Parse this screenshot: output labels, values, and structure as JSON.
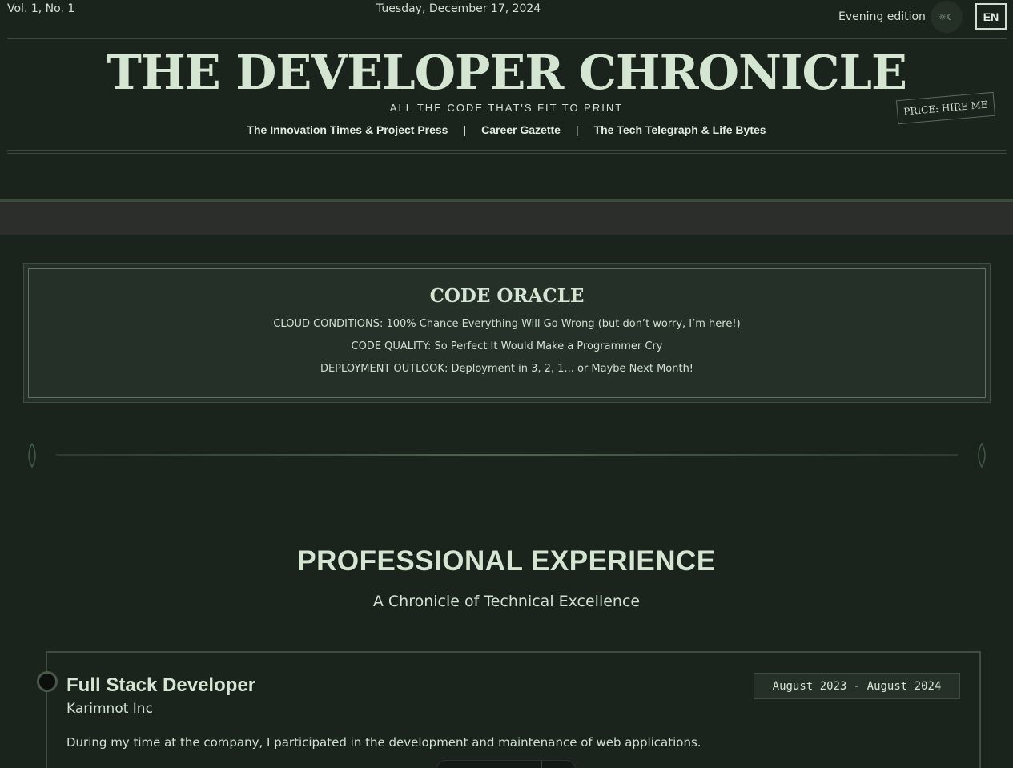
{
  "header": {
    "volume": "Vol. 1, No. 1",
    "date": "Tuesday, December 17, 2024",
    "edition": "Evening edition",
    "theme_toggle_glyph": "☼☾",
    "language": "EN",
    "masthead": "THE DEVELOPER CHRONICLE",
    "tagline": "ALL THE CODE THAT'S FIT TO PRINT",
    "price": "PRICE: HIRE ME",
    "nav": [
      {
        "label": "The Innovation Times & Project Press"
      },
      {
        "label": "Career Gazette"
      },
      {
        "label": "The Tech Telegraph & Life Bytes"
      }
    ],
    "nav_separator": "|"
  },
  "oracle": {
    "title": "CODE ORACLE",
    "lines": [
      "CLOUD CONDITIONS: 100% Chance Everything Will Go Wrong (but don’t worry, I’m here!)",
      "CODE QUALITY: So Perfect It Would Make a Programmer Cry",
      "DEPLOYMENT OUTLOOK: Deployment in 3, 2, 1... or Maybe Next Month!"
    ]
  },
  "experience": {
    "title": "PROFESSIONAL EXPERIENCE",
    "subtitle": "A Chronicle of Technical Excellence",
    "jobs": [
      {
        "title": "Full Stack Developer",
        "company": "Karimnot Inc",
        "dates": "August 2023 - August 2024",
        "description": "During my time at the company, I participated in the development and maintenance of web applications."
      }
    ]
  },
  "colors": {
    "background": "#1b231d",
    "text": "#cfe0cf",
    "accent_border": "#3f4d41"
  }
}
